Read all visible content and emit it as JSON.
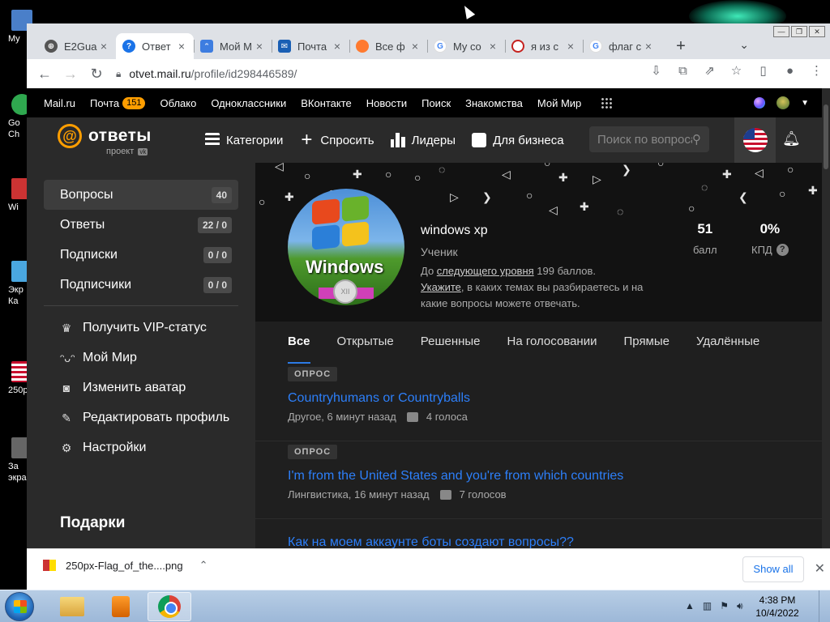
{
  "desktop": {
    "icons": [
      {
        "label": "My",
        "color": "#4a7fc9"
      },
      {
        "label": "Go\nCh",
        "color": "#2fa84f"
      },
      {
        "label": "Wi",
        "color": "#c33"
      },
      {
        "label": "Экр\nКа",
        "color": "#4aa7e0"
      },
      {
        "label": "250p",
        "color": "#c8102e"
      },
      {
        "label": "За\nэкра",
        "color": "#666"
      }
    ]
  },
  "window_controls": {
    "minimize": "—",
    "maximize": "❐",
    "close": "✕"
  },
  "tabs": [
    {
      "title": "E2Gua",
      "icon_color": "#555",
      "icon": "globe-icon",
      "active": false
    },
    {
      "title": "Ответ",
      "icon_color": "#1a73e8",
      "icon": "question-icon",
      "active": true
    },
    {
      "title": "Мой М",
      "icon_color": "#3d7de0",
      "icon": "moi-mir-icon",
      "active": false
    },
    {
      "title": "Почта",
      "icon_color": "#1a5fb4",
      "icon": "mail-icon",
      "active": false
    },
    {
      "title": "Все ф",
      "icon_color": "#ff7a2f",
      "icon": "cloud-icon",
      "active": false
    },
    {
      "title": "My co",
      "icon_color": "#4285f4",
      "icon": "google-icon",
      "active": false
    },
    {
      "title": "я из с",
      "icon_color": "#c5221f",
      "icon": "spiral-icon",
      "active": false
    },
    {
      "title": "флаг с",
      "icon_color": "#4285f4",
      "icon": "google-icon",
      "active": false
    }
  ],
  "tab_close": "×",
  "new_tab": "+",
  "tab_search": "⌄",
  "address": {
    "host": "otvet.mail.ru",
    "path": "/profile/id298446589/"
  },
  "portal": {
    "links": [
      "Mail.ru",
      "Почта",
      "Облако",
      "Одноклассники",
      "ВКонтакте",
      "Новости",
      "Поиск",
      "Знакомства",
      "Мой Мир"
    ],
    "mail_count": "151"
  },
  "header": {
    "logo_text": "ответы",
    "logo_sub": "проект",
    "logo_badge": "vk",
    "nav": [
      "Категории",
      "Спросить",
      "Лидеры",
      "Для бизнеса"
    ],
    "search_placeholder": "Поиск по вопросам"
  },
  "sidebar": {
    "counters": [
      {
        "label": "Вопросы",
        "count": "40",
        "active": true
      },
      {
        "label": "Ответы",
        "count": "22 / 0"
      },
      {
        "label": "Подписки",
        "count": "0 / 0"
      },
      {
        "label": "Подписчики",
        "count": "0 / 0"
      }
    ],
    "links": [
      {
        "label": "Получить VIP-статус",
        "icon": "vip-icon"
      },
      {
        "label": "Мой Мир",
        "icon": "moi-mir-icon"
      },
      {
        "label": "Изменить аватар",
        "icon": "camera-icon"
      },
      {
        "label": "Редактировать профиль",
        "icon": "edit-user-icon"
      },
      {
        "label": "Настройки",
        "icon": "gear-icon"
      }
    ],
    "gifts_title": "Подарки"
  },
  "profile": {
    "avatar_text": "Windows",
    "avatar_badge": "XII",
    "name": "windows xp",
    "rank": "Ученик",
    "next_level_prefix": "До ",
    "next_level_link": "следующего уровня",
    "next_level_suffix": " 199 баллов.",
    "topics_link": "Укажите",
    "topics_text": ", в каких темах вы разбираетесь и на какие вопросы можете отвечать.",
    "points_value": "51",
    "points_label": "балл",
    "kpd_value": "0%",
    "kpd_label": "КПД"
  },
  "filters": [
    "Все",
    "Открытые",
    "Решенные",
    "На голосовании",
    "Прямые",
    "Удалённые"
  ],
  "questions": [
    {
      "tag": "ОПРОС",
      "title": "Countryhumans or Countryballs",
      "meta": "Другое, 6 минут назад",
      "votes": "4 голоса"
    },
    {
      "tag": "ОПРОС",
      "title": "I'm from the United States and you're from which countries",
      "meta": "Лингвистика, 16 минут назад",
      "votes": "7 голосов"
    },
    {
      "tag": "",
      "title": "Как на моем аккаунте боты создают вопросы??",
      "meta": "",
      "votes": ""
    }
  ],
  "download": {
    "filename": "250px-Flag_of_the....png",
    "show_all": "Show all"
  },
  "taskbar": {
    "time": "4:38 PM",
    "date": "10/4/2022"
  }
}
